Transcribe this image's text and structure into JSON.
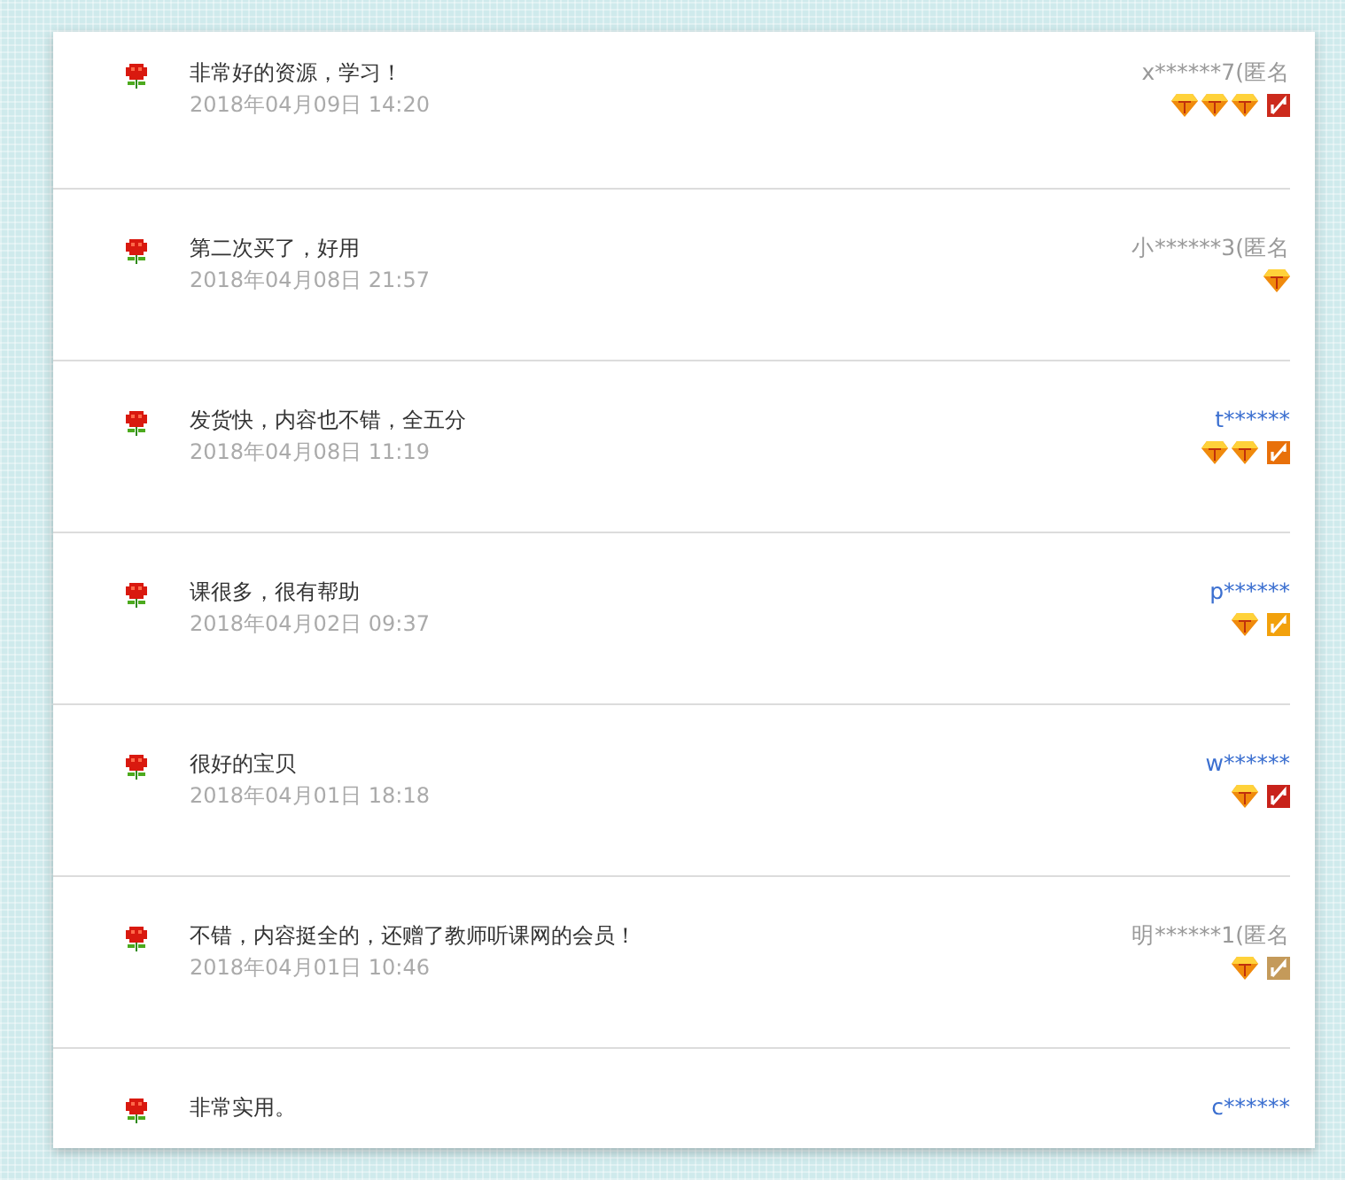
{
  "reviews": [
    {
      "comment": "非常好的资源，学习！",
      "date": "2018年04月09日 14:20",
      "user": "x******7(匿名",
      "anonymous": true,
      "badges": [
        {
          "kind": "gem"
        },
        {
          "kind": "gem"
        },
        {
          "kind": "gem"
        },
        {
          "kind": "grade",
          "color": "#cc2a1c"
        }
      ]
    },
    {
      "comment": "第二次买了，好用",
      "date": "2018年04月08日 21:57",
      "user": "小******3(匿名",
      "anonymous": true,
      "badges": [
        {
          "kind": "gem"
        }
      ]
    },
    {
      "comment": "发货快，内容也不错，全五分",
      "date": "2018年04月08日 11:19",
      "user": "t******",
      "anonymous": false,
      "badges": [
        {
          "kind": "gem"
        },
        {
          "kind": "gem"
        },
        {
          "kind": "grade",
          "color": "#e8700a"
        }
      ]
    },
    {
      "comment": "课很多，很有帮助",
      "date": "2018年04月02日 09:37",
      "user": "p******",
      "anonymous": false,
      "badges": [
        {
          "kind": "gem"
        },
        {
          "kind": "grade",
          "color": "#f2a10c"
        }
      ]
    },
    {
      "comment": "很好的宝贝",
      "date": "2018年04月01日 18:18",
      "user": "w******",
      "anonymous": false,
      "badges": [
        {
          "kind": "gem"
        },
        {
          "kind": "grade",
          "color": "#c8221a"
        }
      ]
    },
    {
      "comment": "不错，内容挺全的，还赠了教师听课网的会员！",
      "date": "2018年04月01日 10:46",
      "user": "明******1(匿名",
      "anonymous": true,
      "badges": [
        {
          "kind": "gem"
        },
        {
          "kind": "grade",
          "color": "#c49a5a"
        }
      ]
    },
    {
      "comment": "非常实用。",
      "user": "c******",
      "anonymous": false
    }
  ]
}
